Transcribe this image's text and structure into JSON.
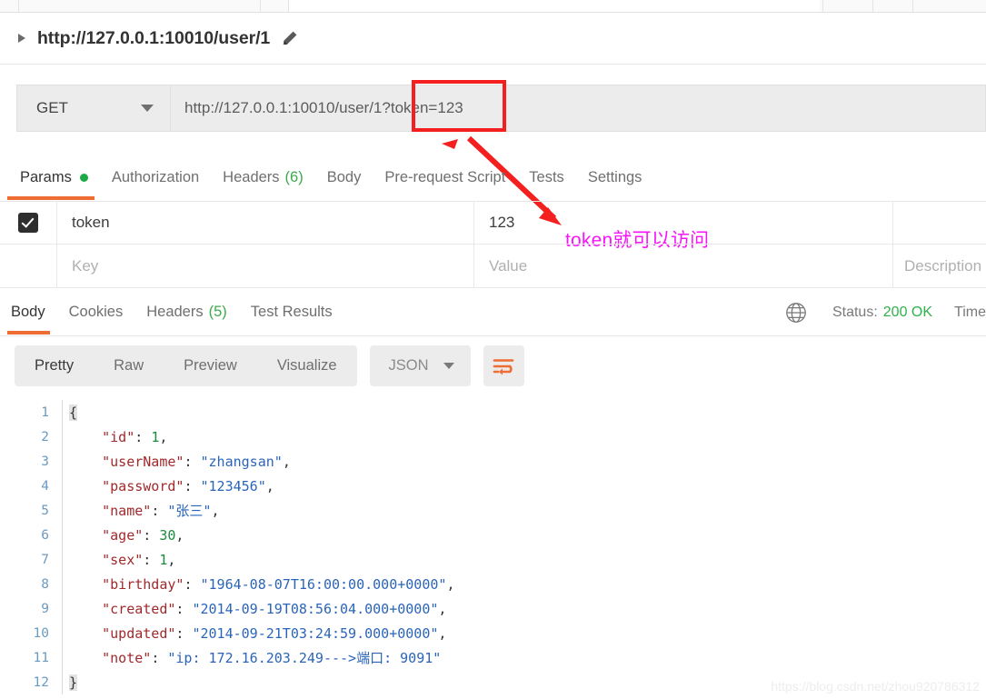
{
  "window": {
    "request_title": "http://127.0.0.1:10010/user/1",
    "caret_icon": "triangle-right-icon",
    "edit_icon": "pencil-icon"
  },
  "url_bar": {
    "method": "GET",
    "method_caret_icon": "chevron-down-icon",
    "url_prefix": "http://127.0.0.1:10010/user/1",
    "url_highlight": "?token=123",
    "full_url": "http://127.0.0.1:10010/user/1?token=123"
  },
  "annotations": {
    "highlight_color": "#f42020",
    "arrow_color": "#f42020",
    "text_color": "#f715f7",
    "note": "token就可以访问"
  },
  "request_tabs": [
    {
      "label": "Params",
      "dot": true,
      "active": true
    },
    {
      "label": "Authorization",
      "active": false
    },
    {
      "label": "Headers",
      "count": "(6)",
      "active": false
    },
    {
      "label": "Body",
      "active": false
    },
    {
      "label": "Pre-request Script",
      "active": false
    },
    {
      "label": "Tests",
      "active": false
    },
    {
      "label": "Settings",
      "active": false
    }
  ],
  "params_table": {
    "rows": [
      {
        "checked": true,
        "key": "token",
        "value": "123",
        "description": ""
      }
    ],
    "placeholder_row": {
      "key": "Key",
      "value": "Value",
      "description": "Description"
    }
  },
  "response_tabs": [
    {
      "label": "Body",
      "active": true
    },
    {
      "label": "Cookies",
      "active": false
    },
    {
      "label": "Headers",
      "count": "(5)",
      "active": false
    },
    {
      "label": "Test Results",
      "active": false
    }
  ],
  "response_meta": {
    "globe_icon": "globe-icon",
    "status_label": "Status:",
    "status_value": "200 OK",
    "status_color": "#2db24b",
    "time_label": "Time"
  },
  "body_toolbar": {
    "formats": [
      {
        "label": "Pretty",
        "active": true
      },
      {
        "label": "Raw",
        "active": false
      },
      {
        "label": "Preview",
        "active": false
      },
      {
        "label": "Visualize",
        "active": false
      }
    ],
    "language": "JSON",
    "language_caret_icon": "chevron-down-icon",
    "wrap_icon": "word-wrap-icon"
  },
  "json_body": {
    "line_numbers": [
      "1",
      "2",
      "3",
      "4",
      "5",
      "6",
      "7",
      "8",
      "9",
      "10",
      "11",
      "12"
    ],
    "lines": [
      {
        "n": "1",
        "indent": "",
        "type": "brace",
        "text": "{"
      },
      {
        "n": "2",
        "indent": "    ",
        "type": "pair",
        "key": "\"id\"",
        "sep": ": ",
        "value": "1",
        "vtype": "num",
        "comma": ","
      },
      {
        "n": "3",
        "indent": "    ",
        "type": "pair",
        "key": "\"userName\"",
        "sep": ": ",
        "value": "\"zhangsan\"",
        "vtype": "str",
        "comma": ","
      },
      {
        "n": "4",
        "indent": "    ",
        "type": "pair",
        "key": "\"password\"",
        "sep": ": ",
        "value": "\"123456\"",
        "vtype": "str",
        "comma": ","
      },
      {
        "n": "5",
        "indent": "    ",
        "type": "pair",
        "key": "\"name\"",
        "sep": ": ",
        "value": "\"张三\"",
        "vtype": "str",
        "comma": ","
      },
      {
        "n": "6",
        "indent": "    ",
        "type": "pair",
        "key": "\"age\"",
        "sep": ": ",
        "value": "30",
        "vtype": "num",
        "comma": ","
      },
      {
        "n": "7",
        "indent": "    ",
        "type": "pair",
        "key": "\"sex\"",
        "sep": ": ",
        "value": "1",
        "vtype": "num",
        "comma": ","
      },
      {
        "n": "8",
        "indent": "    ",
        "type": "pair",
        "key": "\"birthday\"",
        "sep": ": ",
        "value": "\"1964-08-07T16:00:00.000+0000\"",
        "vtype": "str",
        "comma": ","
      },
      {
        "n": "9",
        "indent": "    ",
        "type": "pair",
        "key": "\"created\"",
        "sep": ": ",
        "value": "\"2014-09-19T08:56:04.000+0000\"",
        "vtype": "str",
        "comma": ","
      },
      {
        "n": "10",
        "indent": "    ",
        "type": "pair",
        "key": "\"updated\"",
        "sep": ": ",
        "value": "\"2014-09-21T03:24:59.000+0000\"",
        "vtype": "str",
        "comma": ","
      },
      {
        "n": "11",
        "indent": "    ",
        "type": "pair",
        "key": "\"note\"",
        "sep": ": ",
        "value": "\"ip: 172.16.203.249--->端口: 9091\"",
        "vtype": "str",
        "comma": ""
      },
      {
        "n": "12",
        "indent": "",
        "type": "brace",
        "text": "}"
      }
    ]
  },
  "watermark": "https://blog.csdn.net/zhou920786312"
}
